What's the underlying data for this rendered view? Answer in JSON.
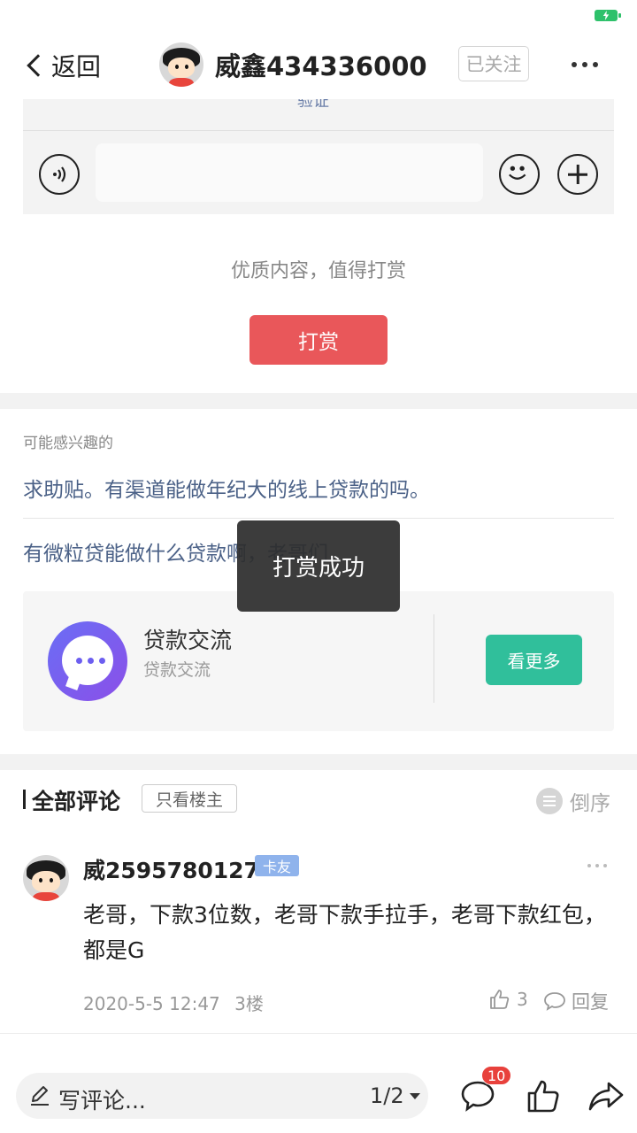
{
  "nav": {
    "back_label": "返回",
    "title": "威鑫434336000",
    "follow_label": "已关注"
  },
  "input_area": {
    "verify_link": "验证"
  },
  "reward": {
    "prompt": "优质内容，值得打赏",
    "button_label": "打赏"
  },
  "related": {
    "section_title": "可能感兴趣的",
    "items": [
      "求助贴。有渠道能做年纪大的线上贷款的吗。",
      "有微粒贷能做什么贷款啊，老哥们"
    ]
  },
  "group": {
    "name": "贷款交流",
    "subtitle": "贷款交流",
    "button_label": "看更多"
  },
  "comments": {
    "title": "全部评论",
    "owner_only_label": "只看楼主",
    "order_label": "倒序",
    "items": [
      {
        "user": "威2595780127",
        "badge": "卡友",
        "text": "老哥，下款3位数，老哥下款手拉手，老哥下款红包，都是G",
        "date": "2020-5-5 12:47",
        "floor": "3楼",
        "likes": "3",
        "reply_label": "回复"
      }
    ]
  },
  "bottom_bar": {
    "write_placeholder": "写评论...",
    "page_indicator": "1/2",
    "comment_badge": "10"
  },
  "toast": {
    "message": "打赏成功"
  },
  "colors": {
    "reward_button": "#e9575a",
    "group_button": "#30bf9b",
    "link": "#4b6187",
    "badge_red": "#e8413c",
    "user_badge": "#8fb3ec",
    "battery": "#2ec16b"
  },
  "icons": [
    "back-chevron-icon",
    "more-dots-icon",
    "voice-icon",
    "emoji-icon",
    "plus-icon",
    "chat-bubble-icon",
    "sort-icon",
    "thumbs-up-icon",
    "reply-icon",
    "pencil-icon",
    "share-icon",
    "battery-icon"
  ]
}
